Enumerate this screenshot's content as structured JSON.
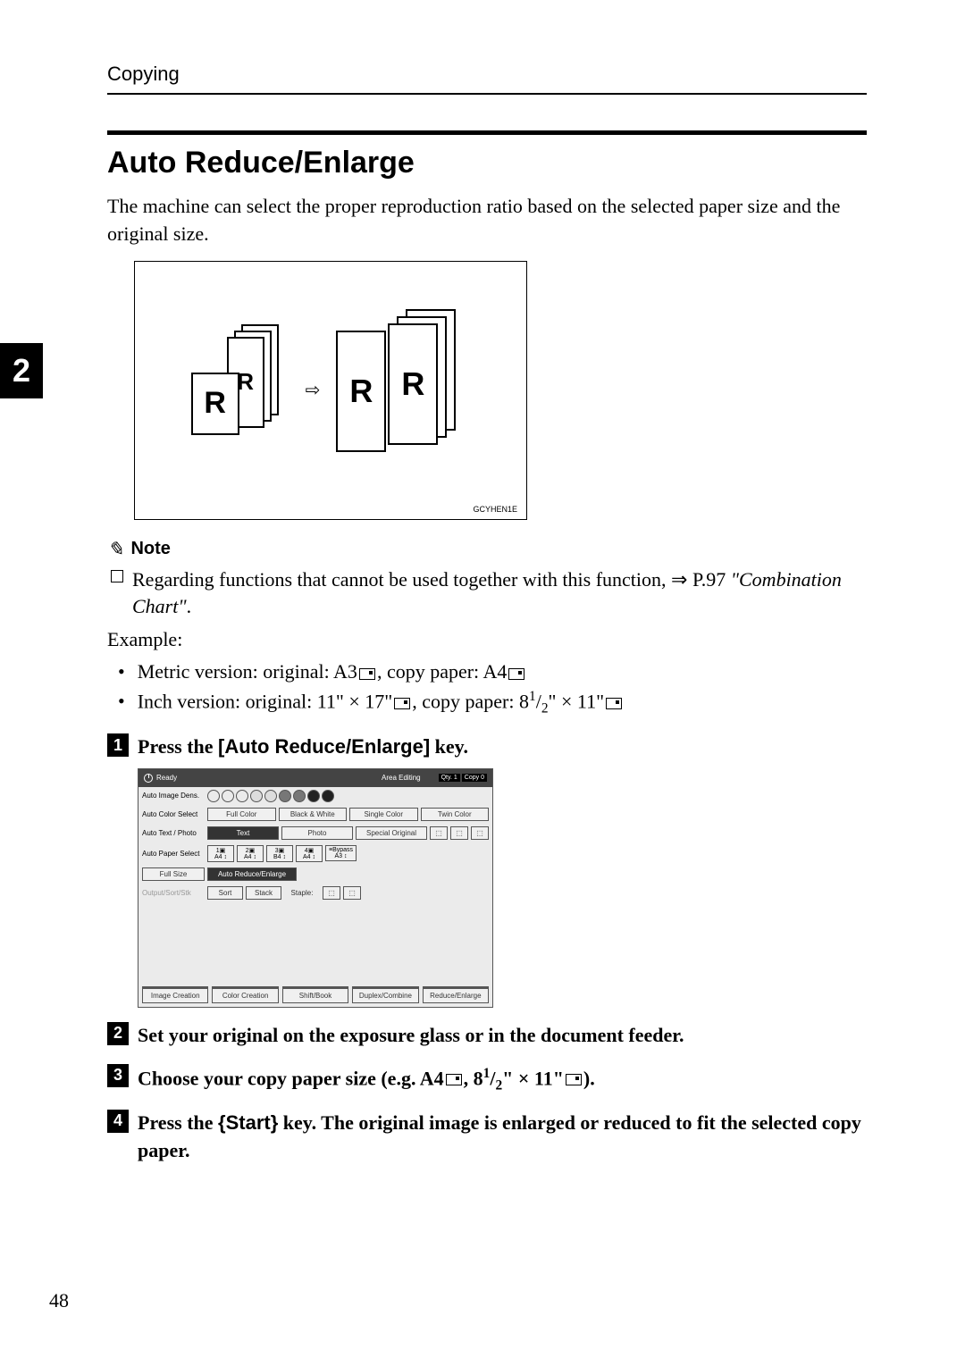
{
  "header": {
    "section": "Copying"
  },
  "chapter_tab": "2",
  "title": "Auto Reduce/Enlarge",
  "intro": "The machine can select the proper reproduction ratio based on the selected paper size and the original size.",
  "illustration": {
    "code": "GCYHEN1E",
    "letter": "R"
  },
  "note": {
    "label": "Note",
    "text_before": "Regarding functions that cannot be used together with this function, ⇒ P.97 ",
    "reference": "\"Combination Chart\""
  },
  "example": {
    "label": "Example:",
    "bullets": [
      {
        "prefix": "Metric version: original: A3",
        "mid": ", copy paper: A4"
      },
      {
        "prefix": "Inch version: original: 11\" × 17\"",
        "mid": ", copy paper: 8",
        "frac_num": "1",
        "frac_den": "2",
        "suffix": "\" × 11\""
      }
    ]
  },
  "steps": [
    {
      "num": "1",
      "before": "Press the ",
      "key": "[Auto Reduce/Enlarge]",
      "after": " key."
    },
    {
      "num": "2",
      "before": "Set your original on the exposure glass or in the document feeder.",
      "key": "",
      "after": ""
    },
    {
      "num": "3",
      "before": "Choose your copy paper size (e.g. A4",
      "key": "",
      "after": "",
      "has_icon": true,
      "mid": ", 8",
      "frac_num": "1",
      "frac_den": "2",
      "suffix": "\" × 11\"",
      "end": ")."
    },
    {
      "num": "4",
      "before": "Press the ",
      "key": "{Start}",
      "after": " key. The original image is enlarged or reduced to fit the selected copy paper."
    }
  ],
  "panel": {
    "ready": "Ready",
    "area_editing": "Area Editing",
    "qty": {
      "label": "Qty.",
      "value": "1"
    },
    "copy": {
      "label": "Copy",
      "value": "0"
    },
    "rows": {
      "auto_image": "Auto Image Dens.",
      "color_select": {
        "label": "Auto Color Select",
        "options": [
          "Full Color",
          "Black & White",
          "Single Color",
          "Twin Color"
        ]
      },
      "text_photo": {
        "label": "Auto Text / Photo",
        "options": [
          "Text",
          "Photo",
          "Special Original"
        ]
      },
      "paper_select": {
        "label": "Auto Paper Select",
        "trays": [
          "A4",
          "A4",
          "B4",
          "A4",
          "A3"
        ],
        "bypass": "Bypass"
      },
      "full_size": "Full Size",
      "auto_reduce": "Auto Reduce/Enlarge",
      "sort_label": "Output/Sort/Stk",
      "sort_options": [
        "Sort",
        "Stack",
        "Staple:"
      ]
    },
    "bottom": [
      "Image Creation",
      "Color Creation",
      "Shift/Book",
      "Duplex/Combine",
      "Reduce/Enlarge"
    ]
  },
  "page_number": "48"
}
